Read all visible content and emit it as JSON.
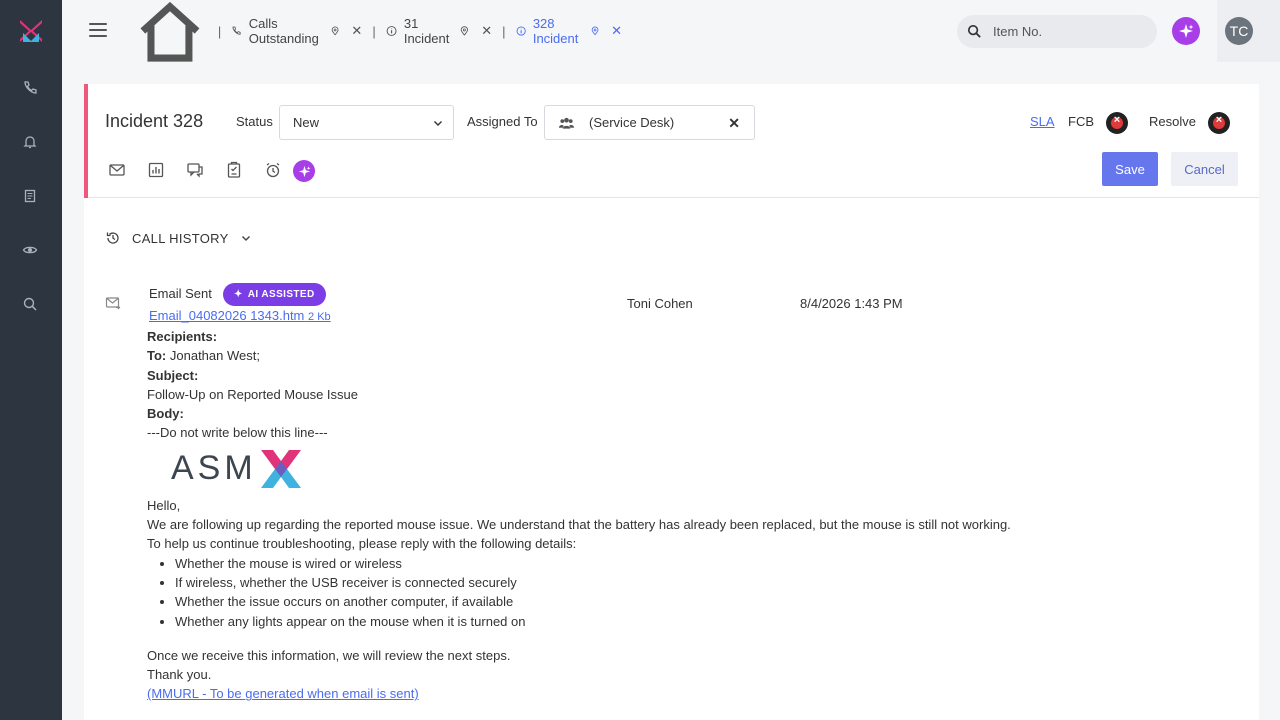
{
  "colors": {
    "rail_bg": "#2d3640",
    "accent_link": "#4a6cf0",
    "ai_purple": "#a83ee8",
    "badge_purple": "#7a3de6",
    "card_accent": "#f0577d",
    "save_button": "#6677ee"
  },
  "sidebar": {
    "icons": [
      "logo-x-icon",
      "phone-icon",
      "bell-icon",
      "book-icon",
      "eye-icon",
      "search-icon"
    ]
  },
  "header": {
    "tabs": [
      {
        "label": "Calls Outstanding",
        "icon": "phone-icon"
      },
      {
        "label": "31 Incident",
        "icon": "info-icon"
      },
      {
        "label": "328 Incident",
        "icon": "info-icon",
        "active": true
      }
    ],
    "search_placeholder": "Item No.",
    "avatar_initials": "TC"
  },
  "incident": {
    "title": "Incident 328",
    "status_label": "Status",
    "status_value": "New",
    "assigned_label": "Assigned To",
    "assigned_value": "(Service Desk)",
    "sla_label": "SLA",
    "fcb_label": "FCB",
    "resolve_label": "Resolve",
    "save_label": "Save",
    "cancel_label": "Cancel"
  },
  "call_history": {
    "heading": "CALL HISTORY",
    "entry": {
      "title": "Email Sent",
      "badge": "AI ASSISTED",
      "attachment_name": "Email_04082026 1343.htm",
      "attachment_size": "2 Kb",
      "agent": "Toni Cohen",
      "timestamp": "8/4/2026 1:43 PM",
      "recipients_label": "Recipients:",
      "to_label": "To:",
      "to_value": "Jonathan West;",
      "subject_label": "Subject:",
      "subject_value": "Follow-Up on Reported Mouse Issue",
      "body_label": "Body:",
      "divider_line": "---Do not write below this line---",
      "brand_word": "ASM",
      "greeting": "Hello,",
      "paragraph1": "We are following up regarding the reported mouse issue. We understand that the battery has already been replaced, but the mouse is still not working.",
      "paragraph2": "To help us continue troubleshooting, please reply with the following details:",
      "bullets": [
        "Whether the mouse is wired or wireless",
        "If wireless, whether the USB receiver is connected securely",
        "Whether the issue occurs on another computer, if available",
        "Whether any lights appear on the mouse when it is turned on"
      ],
      "closing": "Once we receive this information, we will review the next steps.",
      "thanks": "Thank you.",
      "mm_url": "(MMURL - To be generated when email is sent)"
    }
  }
}
